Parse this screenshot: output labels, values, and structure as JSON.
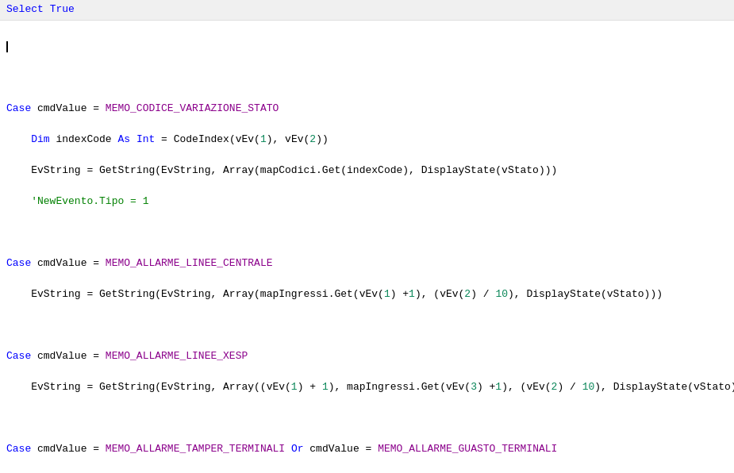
{
  "header": {
    "text": "Select True"
  },
  "lines": [
    {
      "id": "header",
      "content": "Select True",
      "type": "header"
    },
    {
      "id": "cursor",
      "content": "",
      "type": "cursor"
    },
    {
      "id": "l1",
      "type": "code"
    },
    {
      "id": "l2",
      "type": "code"
    },
    {
      "id": "l3",
      "type": "code"
    },
    {
      "id": "l4",
      "type": "code"
    },
    {
      "id": "l5",
      "type": "code"
    },
    {
      "id": "l6",
      "type": "code"
    }
  ],
  "colors": {
    "keyword": "#0000ff",
    "constant": "#8b008b",
    "comment": "#008000",
    "string": "#a31515",
    "number": "#098658",
    "background": "#ffffff",
    "header_bg": "#f8f8f8"
  }
}
